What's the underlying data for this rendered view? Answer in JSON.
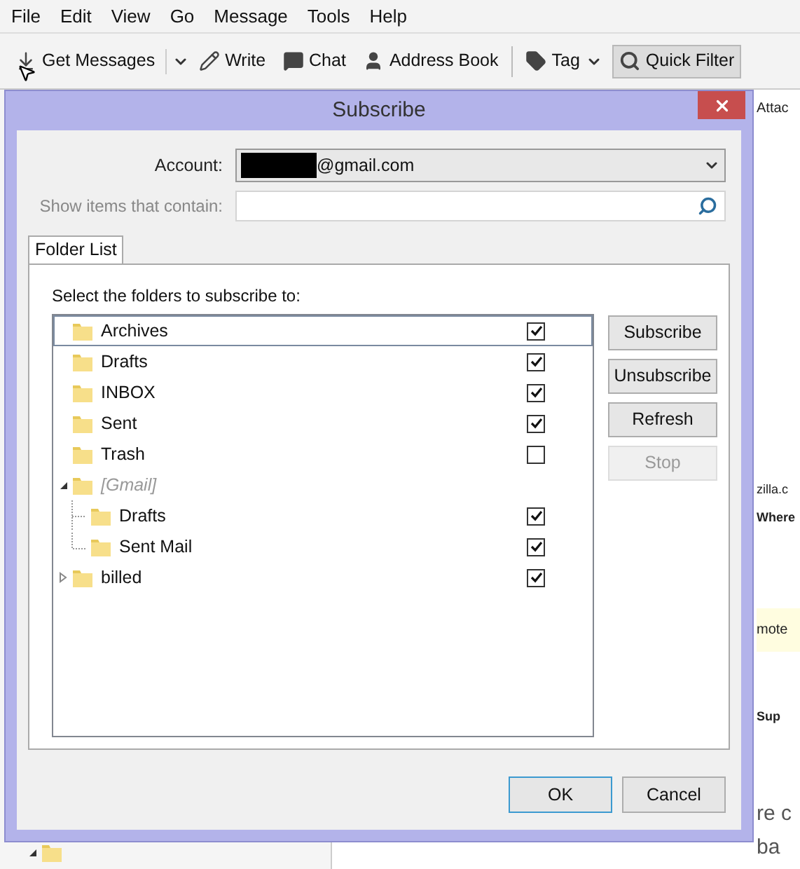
{
  "menu": [
    "File",
    "Edit",
    "View",
    "Go",
    "Message",
    "Tools",
    "Help"
  ],
  "toolbar": [
    {
      "label": "Get Messages",
      "kind": "split",
      "selected": false
    },
    {
      "label": "Write",
      "kind": "button",
      "selected": false
    },
    {
      "label": "Chat",
      "kind": "button",
      "selected": false
    },
    {
      "label": "Address Book",
      "kind": "button",
      "selected": false
    },
    {
      "label": "Tag",
      "kind": "menu",
      "selected": false
    },
    {
      "label": "Quick Filter",
      "kind": "button",
      "selected": true
    }
  ],
  "background_text": [
    {
      "text": "Attac",
      "kind": "tab"
    },
    {
      "text": "zilla.c",
      "kind": "plain"
    },
    {
      "text": "Where",
      "kind": "bold"
    },
    {
      "text": "mote",
      "kind": "banner"
    },
    {
      "text": "Sup",
      "kind": "bold"
    },
    {
      "text": "re c",
      "kind": "large"
    },
    {
      "text": "ba",
      "kind": "large"
    }
  ],
  "dialog": {
    "title": "Subscribe",
    "account": {
      "label": "Account:",
      "value": "@gmail.com",
      "redacted": true
    },
    "filter": {
      "label": "Show items that contain:",
      "disabled": true
    },
    "tabs": [
      {
        "label": "Folder List",
        "selected": true
      }
    ],
    "instruction": "Select the folders to subscribe to:",
    "folders": [
      {
        "name": "Archives",
        "checked": true,
        "selected": true
      },
      {
        "name": "Drafts",
        "checked": true,
        "selected": false
      },
      {
        "name": "INBOX",
        "checked": true,
        "selected": false
      },
      {
        "name": "Sent",
        "checked": true,
        "selected": false
      },
      {
        "name": "Trash",
        "checked": false,
        "selected": false
      },
      {
        "name": "[Gmail]",
        "kind": "virtual",
        "expanded": true,
        "selected": false,
        "children": [
          {
            "name": "Drafts",
            "checked": true,
            "selected": false
          },
          {
            "name": "Sent Mail",
            "checked": true,
            "selected": false
          }
        ]
      },
      {
        "name": "billed",
        "checked": true,
        "expanded": false,
        "selected": false
      }
    ],
    "buttons": [
      {
        "label": "Subscribe",
        "disabled": false
      },
      {
        "label": "Unsubscribe",
        "disabled": false
      },
      {
        "label": "Refresh",
        "disabled": false
      },
      {
        "label": "Stop",
        "disabled": true
      }
    ],
    "footer": [
      {
        "label": "OK",
        "default": true
      },
      {
        "label": "Cancel",
        "default": false
      }
    ]
  }
}
